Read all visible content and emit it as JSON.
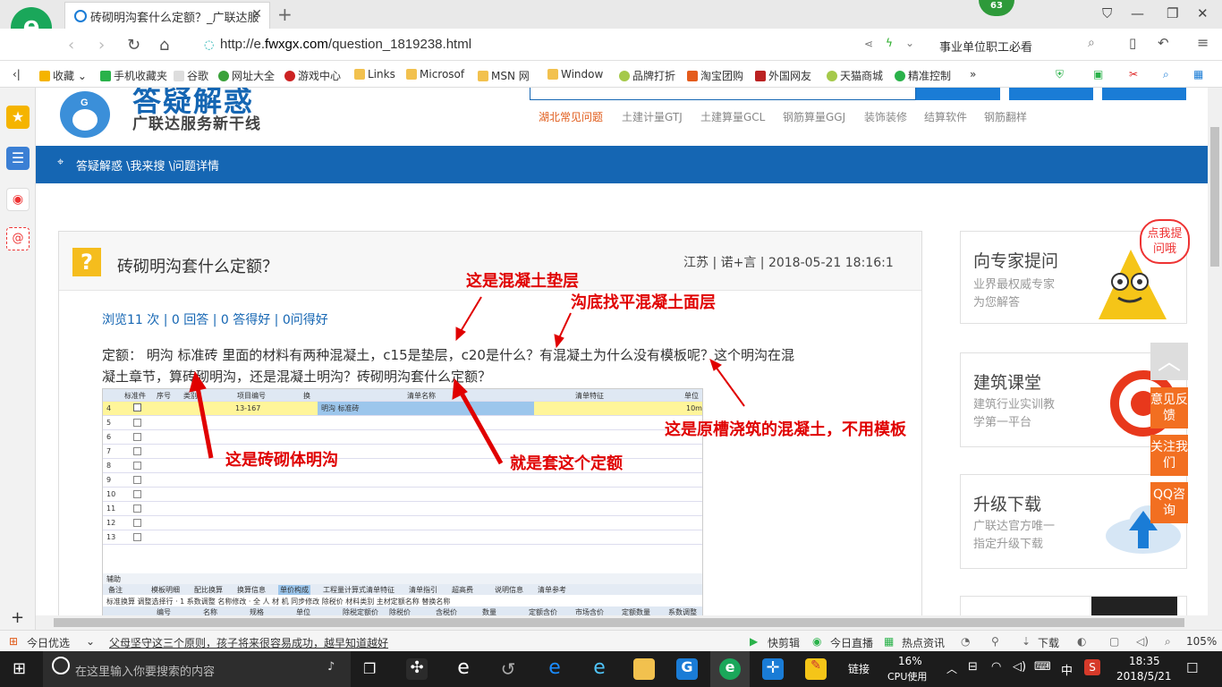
{
  "browser": {
    "tab_title": "砖砌明沟套什么定额？_广联达服",
    "badge_count": "63",
    "url_prefix": "http://e.",
    "url_domain": "fwxgx.com",
    "url_path": "/question_1819238.html",
    "search_text": "事业单位职工必看"
  },
  "bookmarks": [
    "收藏",
    "手机收藏夹",
    "谷歌",
    "网址大全",
    "游戏中心",
    "Links",
    "Microsof",
    "MSN 网",
    "Window",
    "品牌打折",
    "淘宝团购",
    "外国网友",
    "天猫商城",
    "精准控制"
  ],
  "site": {
    "logo_line1": "答疑解惑",
    "logo_line2": "广联达服务新干线",
    "top_links": [
      "湖北常见问题",
      "土建计量GTJ",
      "土建算量GCL",
      "钢筋算量GGJ",
      "装饰装修",
      "结算软件",
      "钢筋翻样"
    ],
    "breadcrumb": "答疑解惑 \\我来搜 \\问题详情"
  },
  "question": {
    "icon": "?",
    "title": "砖砌明沟套什么定额？",
    "meta": "江苏 | 诺+言 | 2018-05-21 18:16:1",
    "stats": "浏览11 次 | 0 回答 | 0 答得好 | 0问得好",
    "body_line1": "定额： 明沟 标准砖   里面的材料有两种混凝土，c15是垫层，c20是什么？有混凝土为什么没有模板呢？这个明沟在混",
    "body_line2": "凝土章节，算砖砌明沟，还是混凝土明沟？砖砌明沟套什么定额？"
  },
  "screenshot": {
    "headers": [
      "标准件",
      "序号",
      "类别",
      "项目编号",
      "换",
      "清单名称",
      "清单特征",
      "单位"
    ],
    "row4": {
      "no": "4",
      "code": "13-167",
      "name": "明沟 标准砖",
      "unit": "10m"
    },
    "row_numbers": [
      "5",
      "6",
      "7",
      "8",
      "9",
      "10",
      "11",
      "12",
      "13"
    ],
    "tab_label": "辅助",
    "tabs": [
      "备注",
      "模板明细",
      "配比换算",
      "换算信息",
      "单价构成",
      "工程量计算式",
      "清单特征",
      "清单指引",
      "超高费",
      "说明信息",
      "清单参考"
    ],
    "toolbar": "标准换算  调整选择行 ·  1  系数调整  名称修改 ·  全 人 材 机    同步修改  除税价  材料类别  主材定额名称  替换名称",
    "table_headers": [
      "编号",
      "名称",
      "规格",
      "单位",
      "除税定额价",
      "除税价",
      "含税价",
      "数量",
      "定额含价",
      "市场含价",
      "定额数量",
      "系数调整"
    ]
  },
  "annotations": {
    "a1": "这是混凝土垫层",
    "a2": "沟底找平混凝土面层",
    "a3": "这是原槽浇筑的混凝土，不用模板",
    "a4": "这是砖砌体明沟",
    "a5": "就是套这个定额"
  },
  "sidebar": {
    "ask_title": "向专家提问",
    "ask_sub1": "业界最权威专家",
    "ask_sub2": "为您解答",
    "ask_bubble": "点我提问哦",
    "course_title": "建筑课堂",
    "course_sub1": "建筑行业实训教",
    "course_sub2": "学第一平台",
    "upgrade_title": "升级下载",
    "upgrade_sub1": "广联达官方唯一",
    "upgrade_sub2": "指定升级下载",
    "feedback": "意见反馈",
    "follow": "关注我们",
    "qq": "QQ咨询"
  },
  "status": {
    "news_label": "今日优选",
    "news_text": "父母坚守这三个原则，孩子将来很容易成功，越早知道越好",
    "items": [
      "快剪辑",
      "今日直播",
      "热点资讯",
      "下载"
    ],
    "zoom": "105%"
  },
  "taskbar": {
    "search_placeholder": "在这里输入你要搜索的内容",
    "link_label": "链接",
    "cpu_pct": "16%",
    "cpu_label": "CPU使用",
    "ime": "中",
    "time": "18:35",
    "date": "2018/5/21"
  },
  "colors": {
    "brand_blue": "#1566b3",
    "annotation_red": "#e00000",
    "float_orange": "#f26f21"
  }
}
